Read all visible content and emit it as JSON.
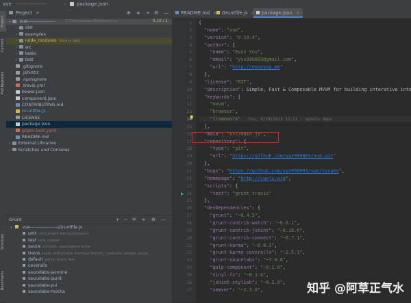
{
  "window": {
    "project_name": "vue",
    "path_sep": "------------------",
    "breadcrumb_file": "package.json"
  },
  "toolstrip": {
    "project_tab": "Project",
    "commit_tab": "Commit",
    "pull_requests_tab": "Pull Requests",
    "structure_tab": "Structure",
    "bookmarks_tab": "Bookmarks"
  },
  "project_panel": {
    "title": "Project",
    "root_label": "vue------------------",
    "root_path": "C:\\Users\\coder\\Desktop\\vue-",
    "root_status": "0.10 / 1",
    "items": [
      {
        "label": "dist",
        "type": "folder",
        "indent": 2
      },
      {
        "label": "examples",
        "type": "folder",
        "indent": 2
      },
      {
        "label": "node_modules",
        "type": "folder",
        "indent": 2,
        "note": "library root"
      },
      {
        "label": "src",
        "type": "folder",
        "indent": 2
      },
      {
        "label": "tasks",
        "type": "folder",
        "indent": 2
      },
      {
        "label": "test",
        "type": "folder",
        "indent": 2
      },
      {
        "label": ".gitignore",
        "type": "gen",
        "indent": 2
      },
      {
        "label": ".jshintrc",
        "type": "gen",
        "indent": 2
      },
      {
        "label": ".npmignore",
        "type": "gen",
        "indent": 2
      },
      {
        "label": ".travis.yml",
        "type": "yml",
        "indent": 2
      },
      {
        "label": "bower.json",
        "type": "json",
        "indent": 2
      },
      {
        "label": "component.json",
        "type": "json",
        "indent": 2
      },
      {
        "label": "CONTRIBUTING.md",
        "type": "md",
        "indent": 2
      },
      {
        "label": "Gruntfile.js",
        "type": "js",
        "indent": 2
      },
      {
        "label": "LICENSE",
        "type": "gen",
        "indent": 2
      },
      {
        "label": "package.json",
        "type": "json",
        "indent": 2
      },
      {
        "label": "pnpm-lock.yaml",
        "type": "yml",
        "indent": 2
      },
      {
        "label": "README.md",
        "type": "md",
        "indent": 2
      },
      {
        "label": "External Libraries",
        "type": "folder",
        "indent": 1
      },
      {
        "label": "Scratches and Consoles",
        "type": "folder",
        "indent": 1
      }
    ]
  },
  "grunt_panel": {
    "title": "Grunt",
    "root": "vue------------------\\Gruntfile.js",
    "tasks": [
      {
        "name": "unit",
        "desc": "instrument, karma:browsers"
      },
      {
        "name": "test",
        "desc": "unit, casper"
      },
      {
        "name": "sauce",
        "desc": "connect, saucelabs-mocha"
      },
      {
        "name": "travis",
        "desc": "build, instrument, karma:phantom, coveralls, casper, sauce"
      },
      {
        "name": "default",
        "desc": "jshint, build, test"
      },
      {
        "name": "coveralls",
        "desc": ""
      },
      {
        "name": "saucelabs-jasmine",
        "desc": ""
      },
      {
        "name": "saucelabs-qunit",
        "desc": ""
      },
      {
        "name": "saucelabs-yui",
        "desc": ""
      },
      {
        "name": "saucelabs-mocha",
        "desc": ""
      }
    ]
  },
  "tabs": [
    {
      "label": "README.md"
    },
    {
      "label": "Gruntfile.js"
    },
    {
      "label": "package.json",
      "active": true
    }
  ],
  "editor": {
    "lines": [
      "{",
      "  \"name\": \"vue\",",
      "  \"version\": \"0.10.4\",",
      "  \"author\": {",
      "    \"name\": \"Evan You\",",
      "    \"email\": \"yyx990803@gmail.com\",",
      "    \"url\": \"http://evanyou.me\"",
      "  },",
      "  \"license\": \"MIT\",",
      "  \"description\": \"Simple, Fast & Composable MVVM for building interative inter",
      "  \"keywords\": [",
      "    \"mvvm\",",
      "    \"browser\",",
      "    \"framework\"",
      "  ],",
      "  \"main\": \"src/main.js\",",
      "  \"repository\": {",
      "    \"type\": \"git\",",
      "    \"url\": \"https://github.com/yyx990803/vue.git\"",
      "  },",
      "  \"bugs\": \"https://github.com/yyx990803/vue/issues\",",
      "  \"homepage\": \"http://vuejs.org\",",
      "  \"scripts\": {",
      "    \"test\": \"grunt travis\"",
      "  },",
      "  \"devDependencies\": {",
      "    \"grunt\": \"~0.4.5\",",
      "    \"grunt-contrib-watch\": \"~0.6.1\",",
      "    \"grunt-contrib-jshint\": \"~0.10.0\",",
      "    \"grunt-contrib-connect\": \"~0.7.1\",",
      "    \"grunt-karma\": \"~0.8.3\",",
      "    \"grunt-karma-coveralls\": \"~2.5.1\",",
      "    \"grunt-saucelabs\": \"~7.0.0\",",
      "    \"gulp-component\": \"~0.1.8\",",
      "    \"vinyl-fs\": \"~0.1.4\",",
      "    \"jshint-stylish\": \"~0.2.0\",",
      "    \"semver\": \"~2.3.0\","
    ],
    "blame": "Yoo, 9/24/2013 12:21 · update deps"
  },
  "watermark": "知乎 @阿草正气水",
  "colors": {
    "highlight_box": "#e02020",
    "accent": "#4a88c7"
  }
}
